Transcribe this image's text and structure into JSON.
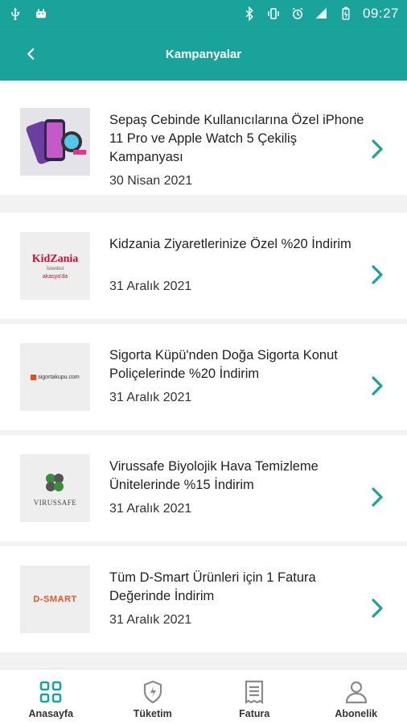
{
  "status_bar": {
    "time": "09:27",
    "left_icons": [
      "usb-icon",
      "android-icon"
    ],
    "right_icons": [
      "bluetooth-icon",
      "vibrate-icon",
      "alarm-icon",
      "wifi-off-icon",
      "signal-icon",
      "battery-icon"
    ]
  },
  "app_bar": {
    "title": "Kampanyalar",
    "back_icon": "chevron-left-icon"
  },
  "campaigns": [
    {
      "title": "Sepaş Cebinde Kullanıcılarına Özel iPhone 11 Pro ve Apple Watch 5 Çekiliş Kampanyası",
      "date": "30 Nisan 2021",
      "thumb": "phones"
    },
    {
      "title": "Kidzania Ziyaretlerinize Özel %20 İndirim",
      "date": "31 Aralık 2021",
      "thumb": "kidzania",
      "logo_text": "KidZania",
      "logo_sub": "İstanbul",
      "logo_tag": "akasya'da"
    },
    {
      "title": "Sigorta Küpü'nden Doğa Sigorta Konut Poliçelerinde %20 İndirim",
      "date": "31 Aralık 2021",
      "thumb": "sigorta",
      "logo_text": "sigortakupu.com"
    },
    {
      "title": "Virussafe Biyolojik Hava Temizleme Ünitelerinde %15 İndirim",
      "date": "31 Aralık 2021",
      "thumb": "virussafe",
      "logo_text": "VIRUSSAFE"
    },
    {
      "title": "Tüm D-Smart Ürünleri için 1 Fatura Değerinde İndirim",
      "date": "31 Aralık 2021",
      "thumb": "dsmart",
      "logo_text": "D-SMART"
    }
  ],
  "bottom_nav": [
    {
      "label": "Anasayfa",
      "icon": "home-grid-icon",
      "active": true
    },
    {
      "label": "Tüketim",
      "icon": "shield-bolt-icon",
      "active": false
    },
    {
      "label": "Fatura",
      "icon": "receipt-icon",
      "active": false
    },
    {
      "label": "Abonelik",
      "icon": "person-icon",
      "active": false
    }
  ],
  "colors": {
    "primary": "#1aa39a",
    "chevron": "#1aa39a",
    "text": "#222222",
    "background": "#f2f2f2"
  }
}
